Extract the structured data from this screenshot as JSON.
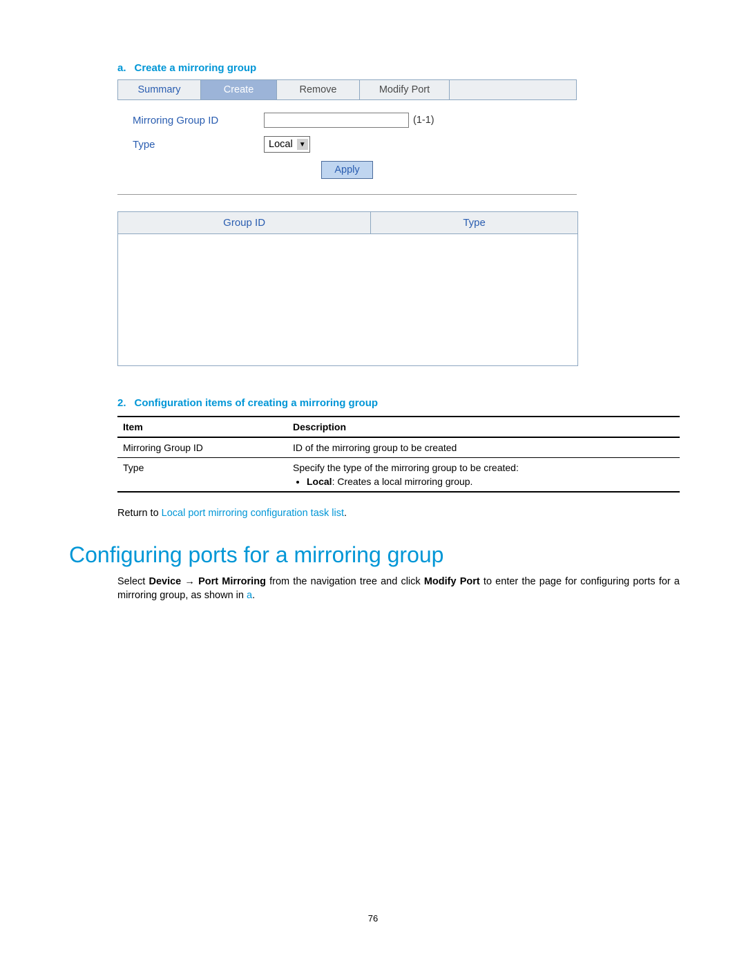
{
  "caption_a": {
    "letter": "a.",
    "text": "Create a mirroring group"
  },
  "tabs": {
    "summary": "Summary",
    "create": "Create",
    "remove": "Remove",
    "modify": "Modify Port"
  },
  "form": {
    "group_id_label": "Mirroring Group ID",
    "group_id_value": "",
    "range": "(1-1)",
    "type_label": "Type",
    "type_value": "Local",
    "apply": "Apply"
  },
  "grid": {
    "col1": "Group ID",
    "col2": "Type"
  },
  "caption_2": {
    "num": "2.",
    "text": "Configuration items of creating a mirroring group"
  },
  "desc_table": {
    "h1": "Item",
    "h2": "Description",
    "r1c1": "Mirroring Group ID",
    "r1c2": "ID of the mirroring group to be created",
    "r2c1": "Type",
    "r2c2_line": "Specify the type of the mirroring group to be created:",
    "r2c2_bullet_bold": "Local",
    "r2c2_bullet_rest": ": Creates a local mirroring group."
  },
  "return_line": {
    "prefix": "Return to ",
    "link": "Local port mirroring configuration task list",
    "suffix": "."
  },
  "h2": "Configuring ports for a mirroring group",
  "para": {
    "t1": "Select ",
    "b1": "Device",
    "arrow": " → ",
    "b2": "Port Mirroring",
    "t2": " from the navigation tree and click ",
    "b3": "Modify Port",
    "t3": " to enter the page for configuring ports for a mirroring group, as shown in ",
    "link": "a",
    "t4": "."
  },
  "page_num": "76"
}
